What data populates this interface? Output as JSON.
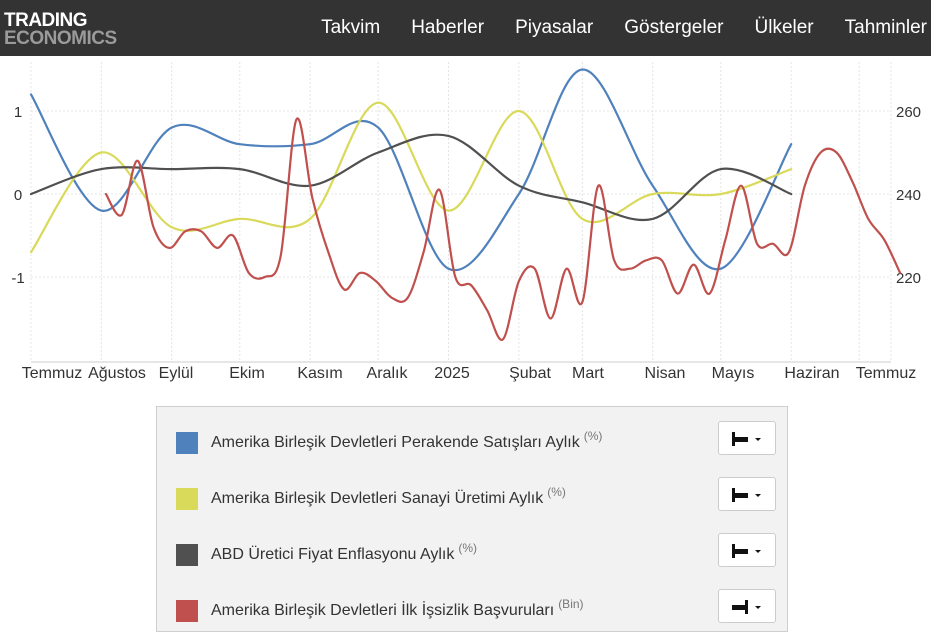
{
  "header": {
    "logo_line1": "TRADING",
    "logo_line2": "ECONOMICS",
    "nav": [
      "Takvim",
      "Haberler",
      "Piyasalar",
      "Göstergeler",
      "Ülkeler",
      "Tahminler"
    ]
  },
  "chart_data": {
    "type": "line",
    "title": "",
    "x_tick_labels": [
      "Temmuz",
      "Ağustos",
      "Eylül",
      "Ekim",
      "Kasım",
      "Aralık",
      "2025",
      "Şubat",
      "Mart",
      "Nisan",
      "Mayıs",
      "Haziran",
      "Temmuz"
    ],
    "y_left": {
      "ticks": [
        1,
        0,
        -1
      ],
      "tick_labels": [
        "1",
        "0",
        "-1"
      ]
    },
    "y_right": {
      "ticks": [
        260,
        240,
        220
      ],
      "tick_labels": [
        "260",
        "240",
        "220"
      ]
    },
    "grid": true,
    "series": [
      {
        "name": "Amerika Birleşik Devletleri Perakende Satışları Aylık",
        "unit": "%",
        "axis": "left",
        "color": "#4f81bd",
        "x": [
          "2024-07",
          "2024-08",
          "2024-09",
          "2024-10",
          "2024-11",
          "2024-12",
          "2025-01",
          "2025-02",
          "2025-03",
          "2025-04",
          "2025-05",
          "2025-06"
        ],
        "values": [
          1.2,
          -0.2,
          0.8,
          0.6,
          0.6,
          0.8,
          -0.9,
          0.0,
          1.5,
          0.1,
          -0.9,
          0.6
        ]
      },
      {
        "name": "Amerika Birleşik Devletleri Sanayi Üretimi Aylık",
        "unit": "%",
        "axis": "left",
        "color": "#d9d95a",
        "x": [
          "2024-07",
          "2024-08",
          "2024-09",
          "2024-10",
          "2024-11",
          "2024-12",
          "2025-01",
          "2025-02",
          "2025-03",
          "2025-04",
          "2025-05",
          "2025-06"
        ],
        "values": [
          -0.7,
          0.5,
          -0.4,
          -0.3,
          -0.3,
          1.1,
          -0.2,
          1.0,
          -0.3,
          0.0,
          0.0,
          0.3
        ]
      },
      {
        "name": "ABD Üretici Fiyat Enflasyonu Aylık",
        "unit": "%",
        "axis": "left",
        "color": "#505050",
        "x": [
          "2024-07",
          "2024-08",
          "2024-09",
          "2024-10",
          "2024-11",
          "2024-12",
          "2025-01",
          "2025-02",
          "2025-03",
          "2025-04",
          "2025-05",
          "2025-06"
        ],
        "values": [
          0.0,
          0.3,
          0.3,
          0.3,
          0.1,
          0.5,
          0.7,
          0.1,
          -0.1,
          -0.3,
          0.3,
          0.0
        ]
      },
      {
        "name": "Amerika Birleşik Devletleri İlk İşsizlik Başvuruları",
        "unit": "Bin",
        "axis": "right",
        "color": "#c0504d",
        "x": [
          "2024-08-03",
          "2024-08-10",
          "2024-08-17",
          "2024-08-24",
          "2024-08-31",
          "2024-09-07",
          "2024-09-14",
          "2024-09-21",
          "2024-09-28",
          "2024-10-05",
          "2024-10-12",
          "2024-10-19",
          "2024-10-26",
          "2024-11-02",
          "2024-11-09",
          "2024-11-16",
          "2024-11-23",
          "2024-11-30",
          "2024-12-07",
          "2024-12-14",
          "2024-12-21",
          "2024-12-28",
          "2025-01-04",
          "2025-01-11",
          "2025-01-18",
          "2025-01-25",
          "2025-02-01",
          "2025-02-08",
          "2025-02-15",
          "2025-02-22",
          "2025-03-01",
          "2025-03-08",
          "2025-03-15",
          "2025-03-22",
          "2025-03-29",
          "2025-04-05",
          "2025-04-12",
          "2025-04-19",
          "2025-04-26",
          "2025-05-03",
          "2025-05-10",
          "2025-05-17",
          "2025-05-24",
          "2025-05-31",
          "2025-06-07",
          "2025-06-14",
          "2025-06-21",
          "2025-06-28",
          "2025-07-05",
          "2025-07-12",
          "2025-07-19"
        ],
        "values": [
          240,
          235,
          248,
          232,
          227,
          231,
          231,
          227,
          230,
          221,
          220,
          225,
          258,
          239,
          226,
          217,
          221,
          219,
          215,
          215,
          226,
          241,
          220,
          218,
          212,
          205,
          219,
          222,
          210,
          222,
          214,
          242,
          224,
          222,
          224,
          224,
          216,
          223,
          216,
          229,
          242,
          228,
          228,
          226,
          242,
          250,
          250,
          243,
          234,
          229,
          221
        ]
      }
    ],
    "legend": [
      {
        "label": "Amerika Birleşik Devletleri Perakende Satışları Aylık",
        "unit": "(%)",
        "color": "#4f81bd",
        "axis_icon": "left-axis-icon"
      },
      {
        "label": "Amerika Birleşik Devletleri Sanayi Üretimi Aylık",
        "unit": "(%)",
        "color": "#d9d95a",
        "axis_icon": "left-axis-icon"
      },
      {
        "label": "ABD Üretici Fiyat Enflasyonu Aylık",
        "unit": "(%)",
        "color": "#505050",
        "axis_icon": "left-axis-icon"
      },
      {
        "label": "Amerika Birleşik Devletleri İlk İşsizlik Başvuruları",
        "unit": "(Bin)",
        "color": "#c0504d",
        "axis_icon": "right-axis-icon"
      }
    ]
  }
}
